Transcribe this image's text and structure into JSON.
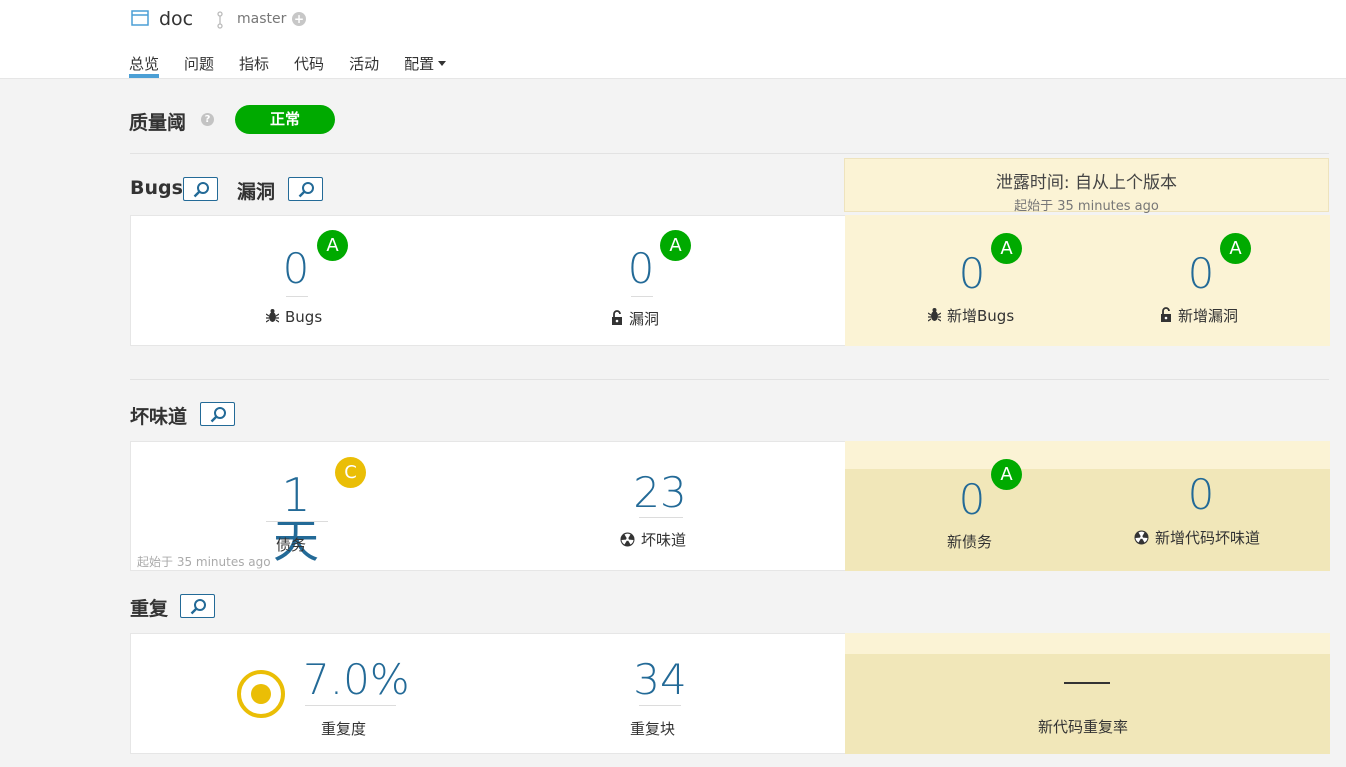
{
  "project": {
    "name": "doc",
    "branch": "master",
    "branch_add": "+"
  },
  "nav": {
    "items": [
      "总览",
      "问题",
      "指标",
      "代码",
      "活动",
      "配置"
    ]
  },
  "quality_gate": {
    "title": "质量阈",
    "help": "?",
    "status": "正常",
    "status_color": "#00aa00"
  },
  "leak_period": {
    "title": "泄露时间: 自从上个版本",
    "subtitle": "起始于 35 minutes ago"
  },
  "reliability": {
    "title_bugs": "Bugs",
    "title_vuln": "漏洞",
    "bugs": {
      "value": "0",
      "rating": "A",
      "label": "Bugs"
    },
    "vulnerabilities": {
      "value": "0",
      "rating": "A",
      "label": "漏洞"
    },
    "new_bugs": {
      "value": "0",
      "rating": "A",
      "label": "新增Bugs"
    },
    "new_vulnerabilities": {
      "value": "0",
      "rating": "A",
      "label": "新增漏洞"
    }
  },
  "maintainability": {
    "title": "坏味道",
    "debt": {
      "value": "1天",
      "rating": "C",
      "label": "债务"
    },
    "smells": {
      "value": "23",
      "label": "坏味道"
    },
    "since": "起始于 35 minutes ago",
    "new_debt": {
      "value": "0",
      "rating": "A",
      "label": "新债务"
    },
    "new_smells": {
      "value": "0",
      "label": "新增代码坏味道"
    }
  },
  "duplications": {
    "title": "重复",
    "density": {
      "value": "7.0%",
      "label": "重复度"
    },
    "blocks": {
      "value": "34",
      "label": "重复块"
    },
    "new_density": {
      "value": "—",
      "label": "新代码重复率"
    }
  },
  "colors": {
    "accent": "#236a97",
    "rating_a": "#00aa00",
    "rating_c": "#eabe06",
    "leak": "#fbf3d5"
  }
}
